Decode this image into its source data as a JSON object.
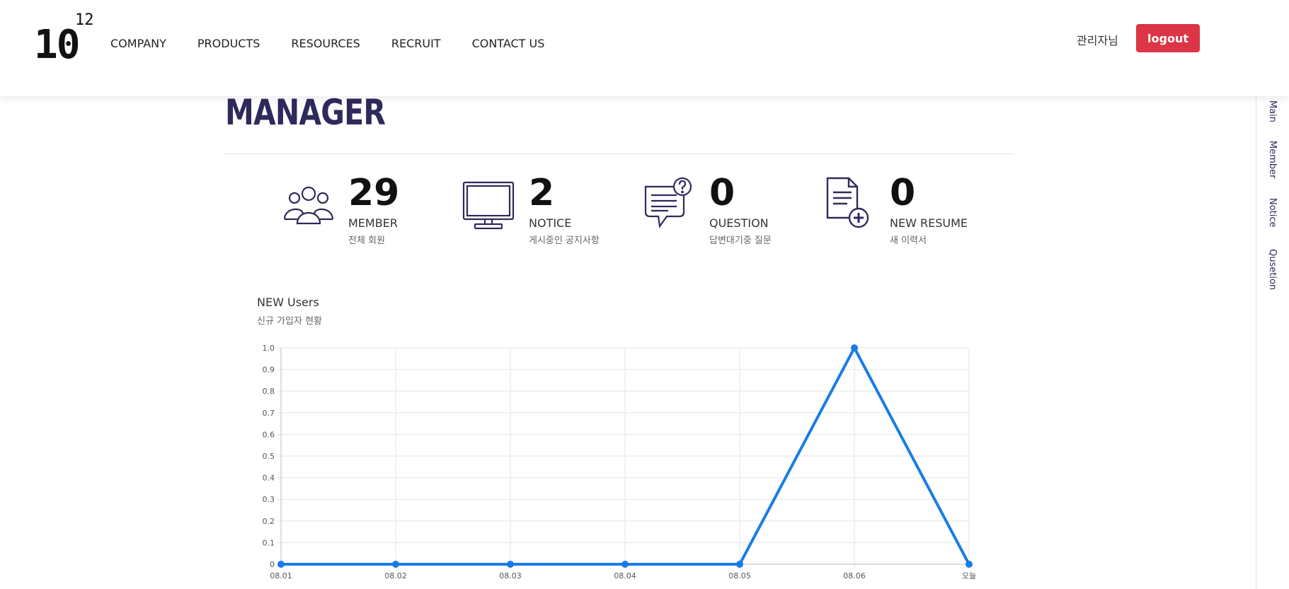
{
  "header": {
    "logo_main": "10",
    "logo_sup": "12",
    "nav": [
      "COMPANY",
      "PRODUCTS",
      "RESOURCES",
      "RECRUIT",
      "CONTACT US"
    ],
    "admin_name": "관리자님",
    "logout_label": "logout"
  },
  "page": {
    "title": "MANAGER"
  },
  "stats": [
    {
      "value": "29",
      "label": "MEMBER",
      "sub": "전체 회원",
      "icon": "users-icon"
    },
    {
      "value": "2",
      "label": "NOTICE",
      "sub": "게시중인 공지사항",
      "icon": "monitor-icon"
    },
    {
      "value": "0",
      "label": "QUESTION",
      "sub": "답변대기중 질문",
      "icon": "question-chat-icon"
    },
    {
      "value": "0",
      "label": "NEW RESUME",
      "sub": "새 이력서",
      "icon": "document-add-icon"
    }
  ],
  "chart": {
    "title": "NEW Users",
    "subtitle": "신규 가입자 현황"
  },
  "chart_data": {
    "type": "line",
    "x": [
      "08.01",
      "08.02",
      "08.03",
      "08.04",
      "08.05",
      "08.06",
      "오늘"
    ],
    "series": [
      {
        "values": [
          0,
          0,
          0,
          0,
          0,
          1,
          0
        ]
      }
    ],
    "ylim": [
      0,
      1.0
    ],
    "yticks": [
      "0",
      "0.1",
      "0.2",
      "0.3",
      "0.4",
      "0.5",
      "0.6",
      "0.7",
      "0.8",
      "0.9",
      "1.0"
    ],
    "grid": true,
    "color": "#1a7be8"
  },
  "sidebar": {
    "links": [
      "Main",
      "Member",
      "Notice",
      "Qusetion"
    ]
  }
}
